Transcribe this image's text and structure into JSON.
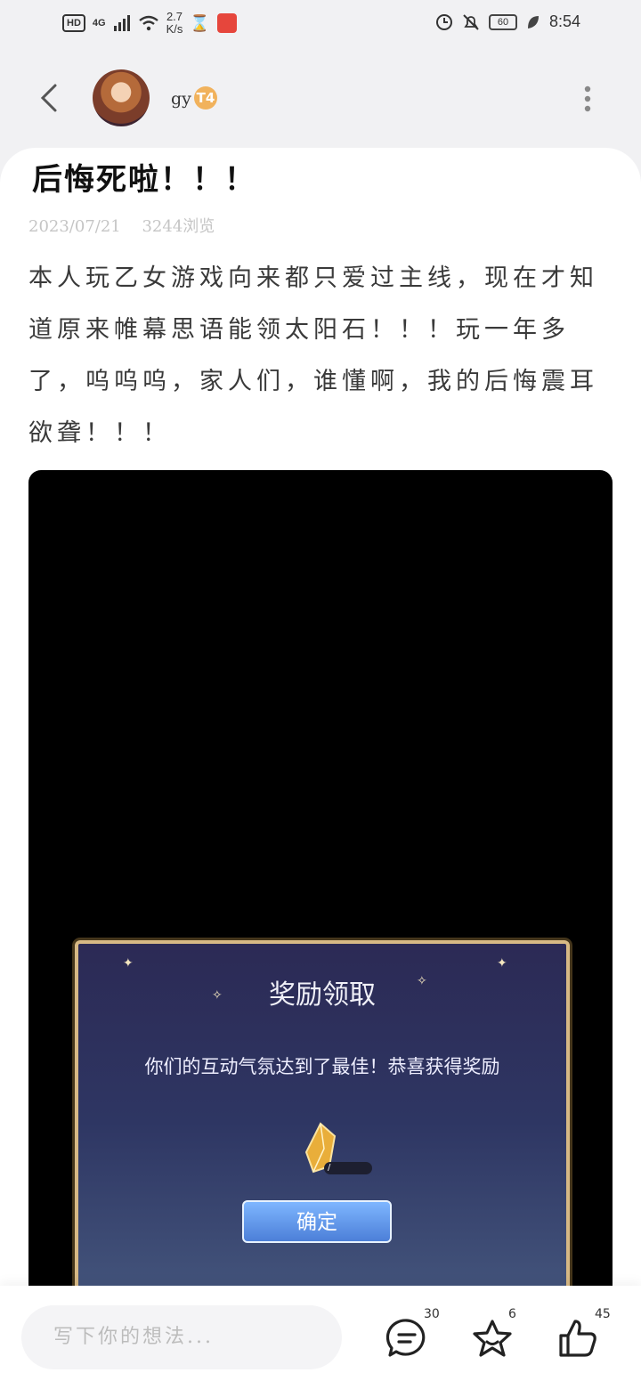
{
  "status_bar": {
    "hd": "HD",
    "network": "4G",
    "speed_value": "2.7",
    "speed_unit": "K/s",
    "battery": "60",
    "time": "8:54"
  },
  "header": {
    "username": "gy",
    "badge": "T4"
  },
  "post": {
    "title": "后悔死啦！！！",
    "date": "2023/07/21",
    "views": "3244浏览",
    "body": "本人玩乙女游戏向来都只爱过主线，现在才知道原来帷幕思语能领太阳石！！！玩一年多了，呜呜呜，家人们，谁懂啊，我的后悔震耳欲聋！！！"
  },
  "dialog": {
    "title": "奖励领取",
    "message": "你们的互动气氛达到了最佳！恭喜获得奖励",
    "count": "/",
    "confirm": "确定"
  },
  "bottom_bar": {
    "placeholder": "写下你的想法...",
    "comments": "30",
    "favorites": "6",
    "likes": "45"
  }
}
